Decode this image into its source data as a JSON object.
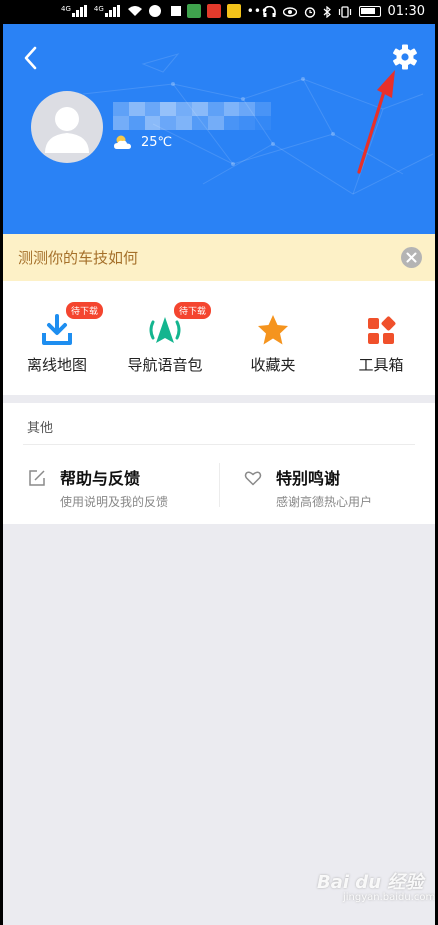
{
  "status_bar": {
    "sim1": "4G",
    "sim2": "4G",
    "time": "01:30"
  },
  "header": {
    "weather_temp": "25℃",
    "brand_color": "#2a82f5",
    "annotation_arrow_color": "#e8302a"
  },
  "banner": {
    "text": "测测你的车技如何"
  },
  "tools": [
    {
      "label": "离线地图",
      "badge": "待下载",
      "icon": "download-icon"
    },
    {
      "label": "导航语音包",
      "badge": "待下载",
      "icon": "voice-navigation-icon"
    },
    {
      "label": "收藏夹",
      "badge": "",
      "icon": "star-icon"
    },
    {
      "label": "工具箱",
      "badge": "",
      "icon": "toolbox-icon"
    }
  ],
  "other": {
    "title": "其他",
    "items": [
      {
        "label": "帮助与反馈",
        "sub": "使用说明及我的反馈",
        "icon": "edit-icon"
      },
      {
        "label": "特别鸣谢",
        "sub": "感谢高德热心用户",
        "icon": "heart-icon"
      }
    ]
  },
  "watermark": {
    "text": "Bai du 经验",
    "sub": "jingyan.baidu.com"
  }
}
